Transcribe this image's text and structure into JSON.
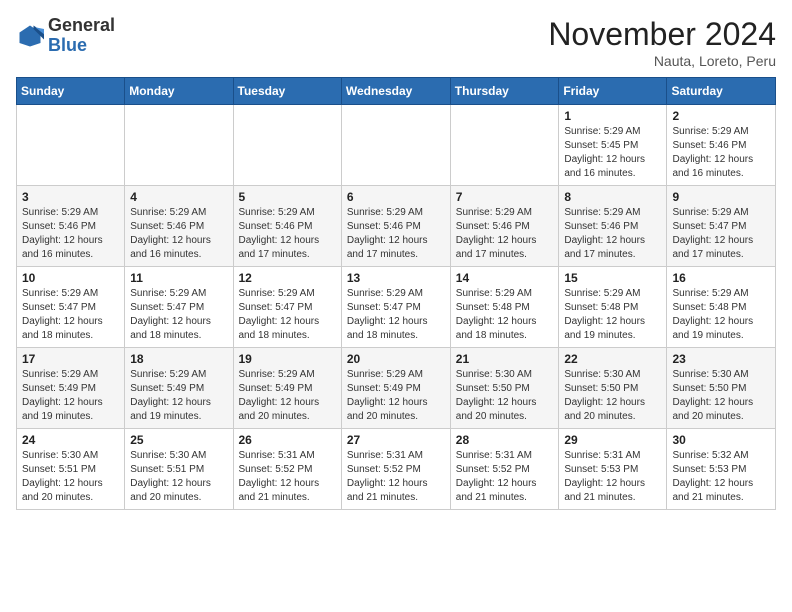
{
  "header": {
    "logo_line1": "General",
    "logo_line2": "Blue",
    "month": "November 2024",
    "location": "Nauta, Loreto, Peru"
  },
  "days_of_week": [
    "Sunday",
    "Monday",
    "Tuesday",
    "Wednesday",
    "Thursday",
    "Friday",
    "Saturday"
  ],
  "weeks": [
    [
      {
        "day": "",
        "info": ""
      },
      {
        "day": "",
        "info": ""
      },
      {
        "day": "",
        "info": ""
      },
      {
        "day": "",
        "info": ""
      },
      {
        "day": "",
        "info": ""
      },
      {
        "day": "1",
        "info": "Sunrise: 5:29 AM\nSunset: 5:45 PM\nDaylight: 12 hours and 16 minutes."
      },
      {
        "day": "2",
        "info": "Sunrise: 5:29 AM\nSunset: 5:46 PM\nDaylight: 12 hours and 16 minutes."
      }
    ],
    [
      {
        "day": "3",
        "info": "Sunrise: 5:29 AM\nSunset: 5:46 PM\nDaylight: 12 hours and 16 minutes."
      },
      {
        "day": "4",
        "info": "Sunrise: 5:29 AM\nSunset: 5:46 PM\nDaylight: 12 hours and 16 minutes."
      },
      {
        "day": "5",
        "info": "Sunrise: 5:29 AM\nSunset: 5:46 PM\nDaylight: 12 hours and 17 minutes."
      },
      {
        "day": "6",
        "info": "Sunrise: 5:29 AM\nSunset: 5:46 PM\nDaylight: 12 hours and 17 minutes."
      },
      {
        "day": "7",
        "info": "Sunrise: 5:29 AM\nSunset: 5:46 PM\nDaylight: 12 hours and 17 minutes."
      },
      {
        "day": "8",
        "info": "Sunrise: 5:29 AM\nSunset: 5:46 PM\nDaylight: 12 hours and 17 minutes."
      },
      {
        "day": "9",
        "info": "Sunrise: 5:29 AM\nSunset: 5:47 PM\nDaylight: 12 hours and 17 minutes."
      }
    ],
    [
      {
        "day": "10",
        "info": "Sunrise: 5:29 AM\nSunset: 5:47 PM\nDaylight: 12 hours and 18 minutes."
      },
      {
        "day": "11",
        "info": "Sunrise: 5:29 AM\nSunset: 5:47 PM\nDaylight: 12 hours and 18 minutes."
      },
      {
        "day": "12",
        "info": "Sunrise: 5:29 AM\nSunset: 5:47 PM\nDaylight: 12 hours and 18 minutes."
      },
      {
        "day": "13",
        "info": "Sunrise: 5:29 AM\nSunset: 5:47 PM\nDaylight: 12 hours and 18 minutes."
      },
      {
        "day": "14",
        "info": "Sunrise: 5:29 AM\nSunset: 5:48 PM\nDaylight: 12 hours and 18 minutes."
      },
      {
        "day": "15",
        "info": "Sunrise: 5:29 AM\nSunset: 5:48 PM\nDaylight: 12 hours and 19 minutes."
      },
      {
        "day": "16",
        "info": "Sunrise: 5:29 AM\nSunset: 5:48 PM\nDaylight: 12 hours and 19 minutes."
      }
    ],
    [
      {
        "day": "17",
        "info": "Sunrise: 5:29 AM\nSunset: 5:49 PM\nDaylight: 12 hours and 19 minutes."
      },
      {
        "day": "18",
        "info": "Sunrise: 5:29 AM\nSunset: 5:49 PM\nDaylight: 12 hours and 19 minutes."
      },
      {
        "day": "19",
        "info": "Sunrise: 5:29 AM\nSunset: 5:49 PM\nDaylight: 12 hours and 20 minutes."
      },
      {
        "day": "20",
        "info": "Sunrise: 5:29 AM\nSunset: 5:49 PM\nDaylight: 12 hours and 20 minutes."
      },
      {
        "day": "21",
        "info": "Sunrise: 5:30 AM\nSunset: 5:50 PM\nDaylight: 12 hours and 20 minutes."
      },
      {
        "day": "22",
        "info": "Sunrise: 5:30 AM\nSunset: 5:50 PM\nDaylight: 12 hours and 20 minutes."
      },
      {
        "day": "23",
        "info": "Sunrise: 5:30 AM\nSunset: 5:50 PM\nDaylight: 12 hours and 20 minutes."
      }
    ],
    [
      {
        "day": "24",
        "info": "Sunrise: 5:30 AM\nSunset: 5:51 PM\nDaylight: 12 hours and 20 minutes."
      },
      {
        "day": "25",
        "info": "Sunrise: 5:30 AM\nSunset: 5:51 PM\nDaylight: 12 hours and 20 minutes."
      },
      {
        "day": "26",
        "info": "Sunrise: 5:31 AM\nSunset: 5:52 PM\nDaylight: 12 hours and 21 minutes."
      },
      {
        "day": "27",
        "info": "Sunrise: 5:31 AM\nSunset: 5:52 PM\nDaylight: 12 hours and 21 minutes."
      },
      {
        "day": "28",
        "info": "Sunrise: 5:31 AM\nSunset: 5:52 PM\nDaylight: 12 hours and 21 minutes."
      },
      {
        "day": "29",
        "info": "Sunrise: 5:31 AM\nSunset: 5:53 PM\nDaylight: 12 hours and 21 minutes."
      },
      {
        "day": "30",
        "info": "Sunrise: 5:32 AM\nSunset: 5:53 PM\nDaylight: 12 hours and 21 minutes."
      }
    ]
  ]
}
